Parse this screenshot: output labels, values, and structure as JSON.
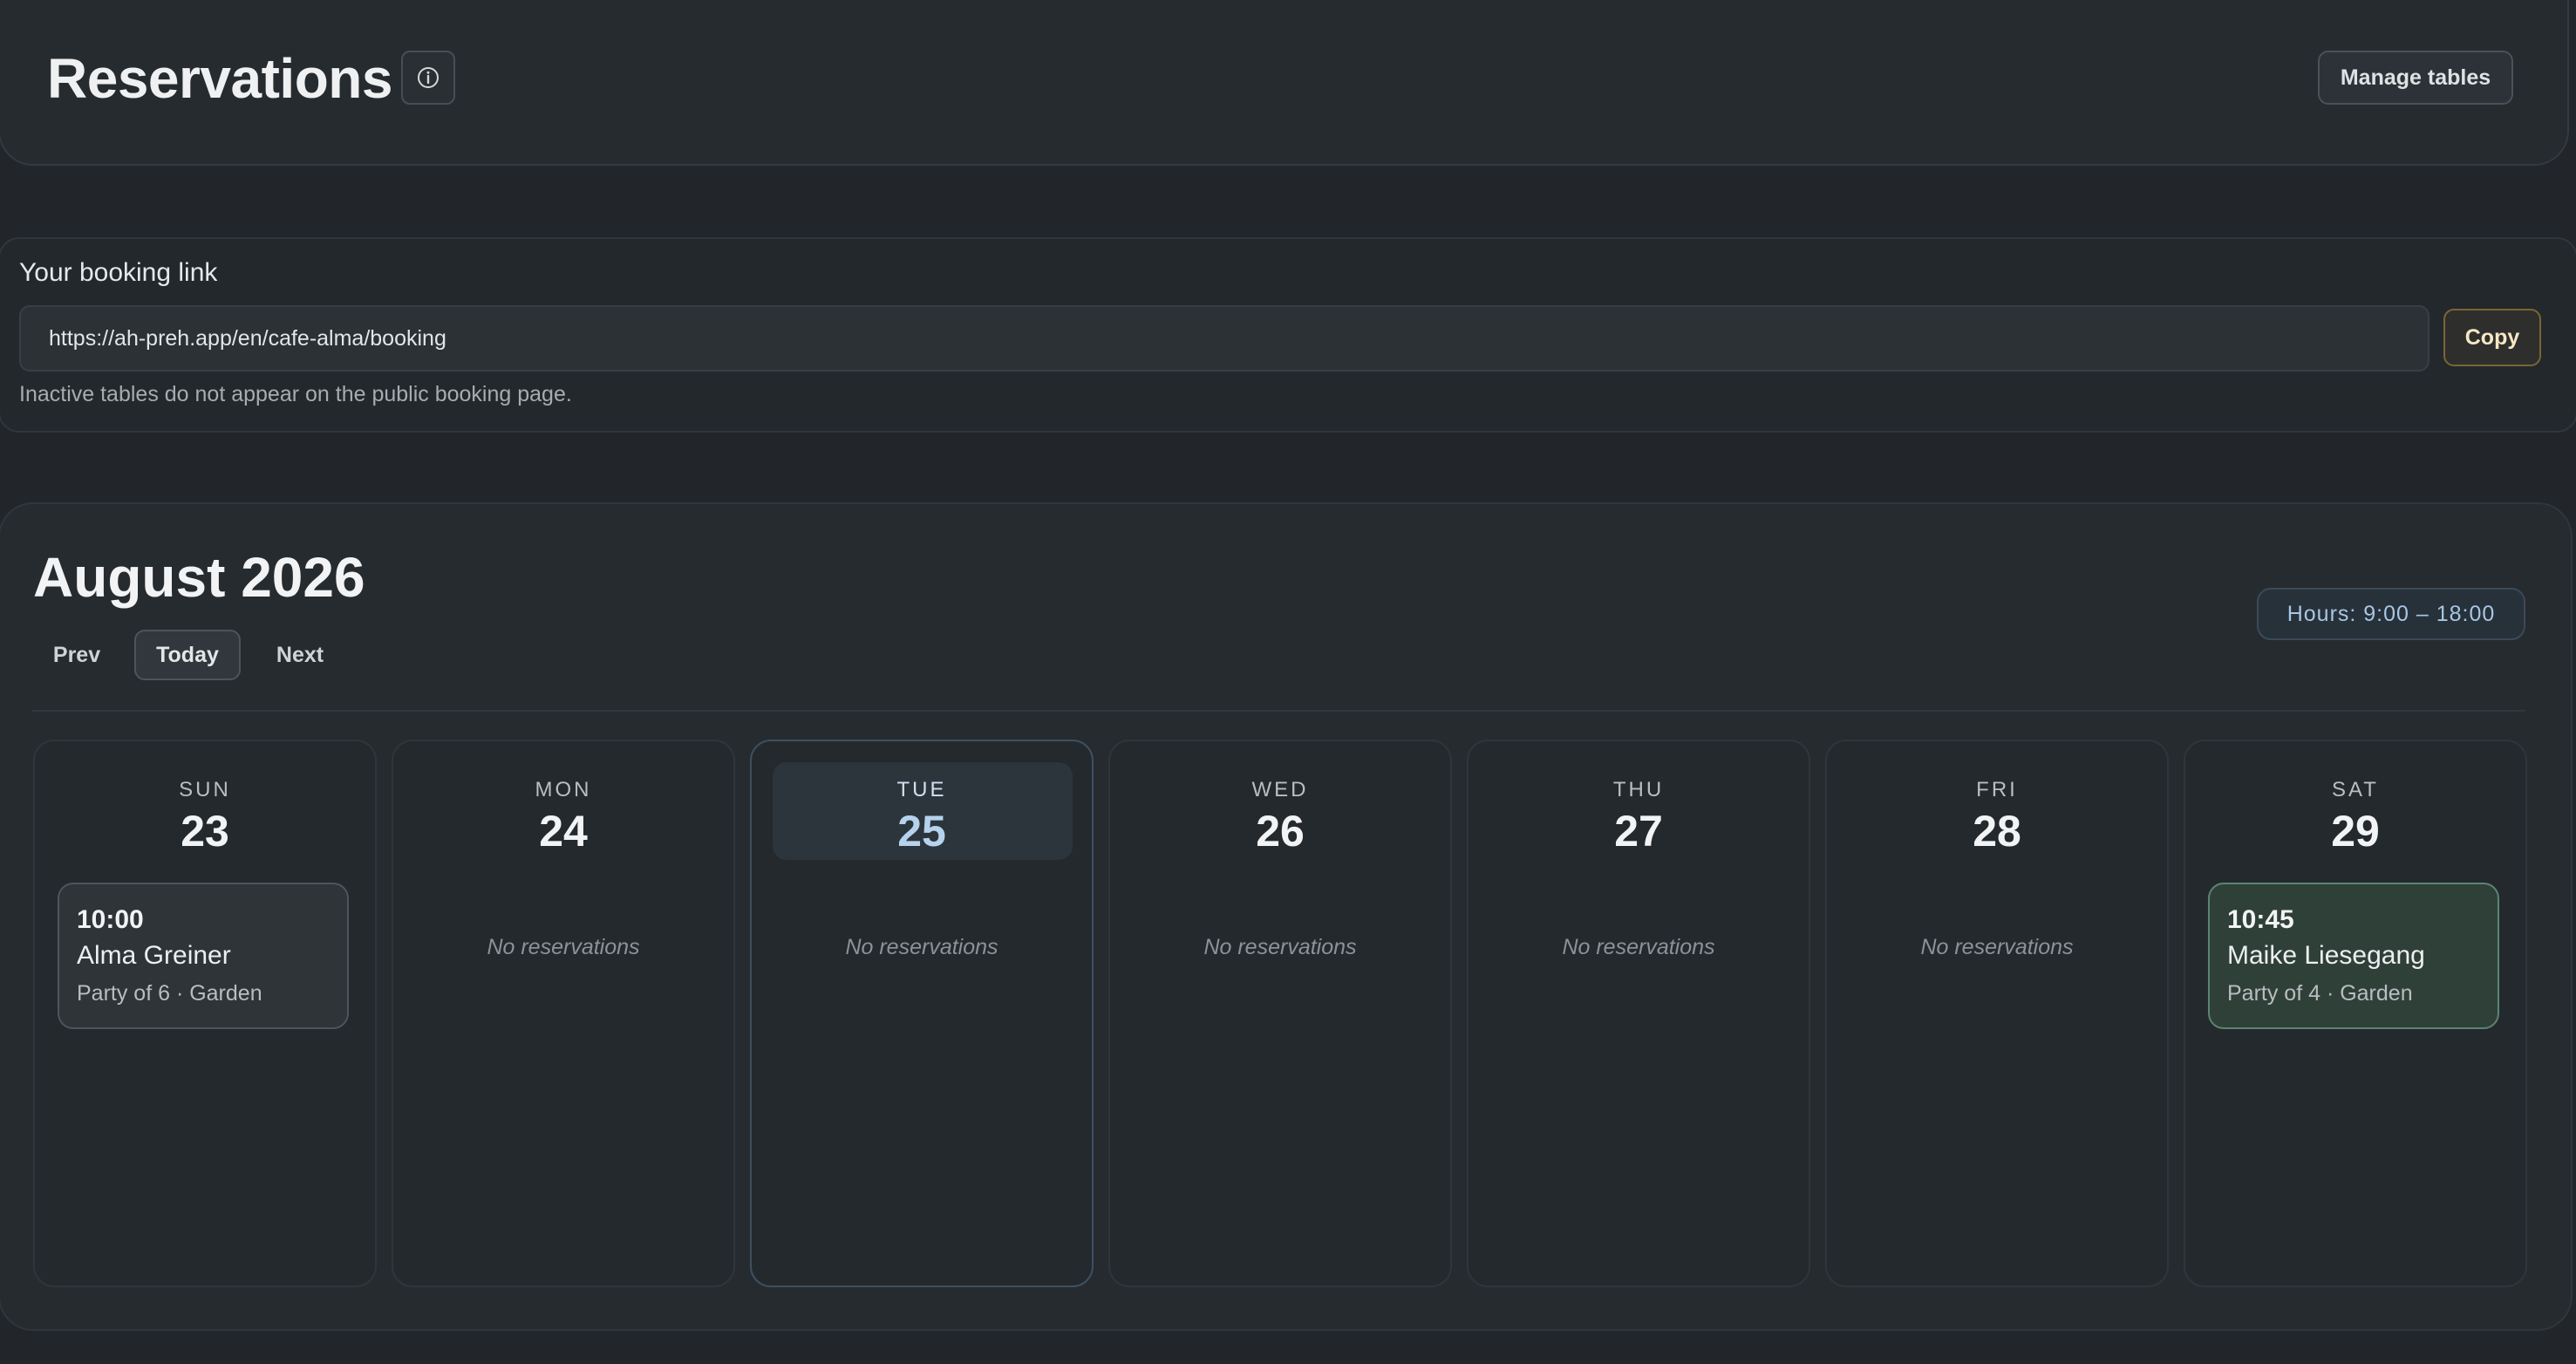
{
  "header": {
    "title": "Reservations",
    "info_icon": "info-circle-icon",
    "manage_label": "Manage tables"
  },
  "booking": {
    "label": "Your booking link",
    "url": "https://ah-preh.app/en/cafe-alma/booking",
    "copy_label": "Copy",
    "hint": "Inactive tables do not appear on the public booking page."
  },
  "calendar": {
    "month": "August 2026",
    "nav": {
      "prev": "Prev",
      "today": "Today",
      "next": "Next"
    },
    "hours": "Hours: 9:00 – 18:00",
    "days": [
      {
        "dow": "SUN",
        "num": "23",
        "empty": "",
        "reservation": {
          "time": "10:00",
          "name": "Alma Greiner",
          "meta": "Party of 6 · Garden"
        }
      },
      {
        "dow": "MON",
        "num": "24",
        "empty": "No reservations"
      },
      {
        "dow": "TUE",
        "num": "25",
        "empty": "No reservations",
        "today": true
      },
      {
        "dow": "WED",
        "num": "26",
        "empty": "No reservations"
      },
      {
        "dow": "THU",
        "num": "27",
        "empty": "No reservations"
      },
      {
        "dow": "FRI",
        "num": "28",
        "empty": "No reservations"
      },
      {
        "dow": "SAT",
        "num": "29",
        "empty": "",
        "reservation": {
          "time": "10:45",
          "name": "Maike Liesegang",
          "meta": "Party of 4 · Garden"
        }
      }
    ]
  },
  "colors": {
    "background": "#22262a",
    "today_accent": "#b6d3ee",
    "copy_accent": "#7a6536",
    "confirmed_card": "#2f4039"
  }
}
